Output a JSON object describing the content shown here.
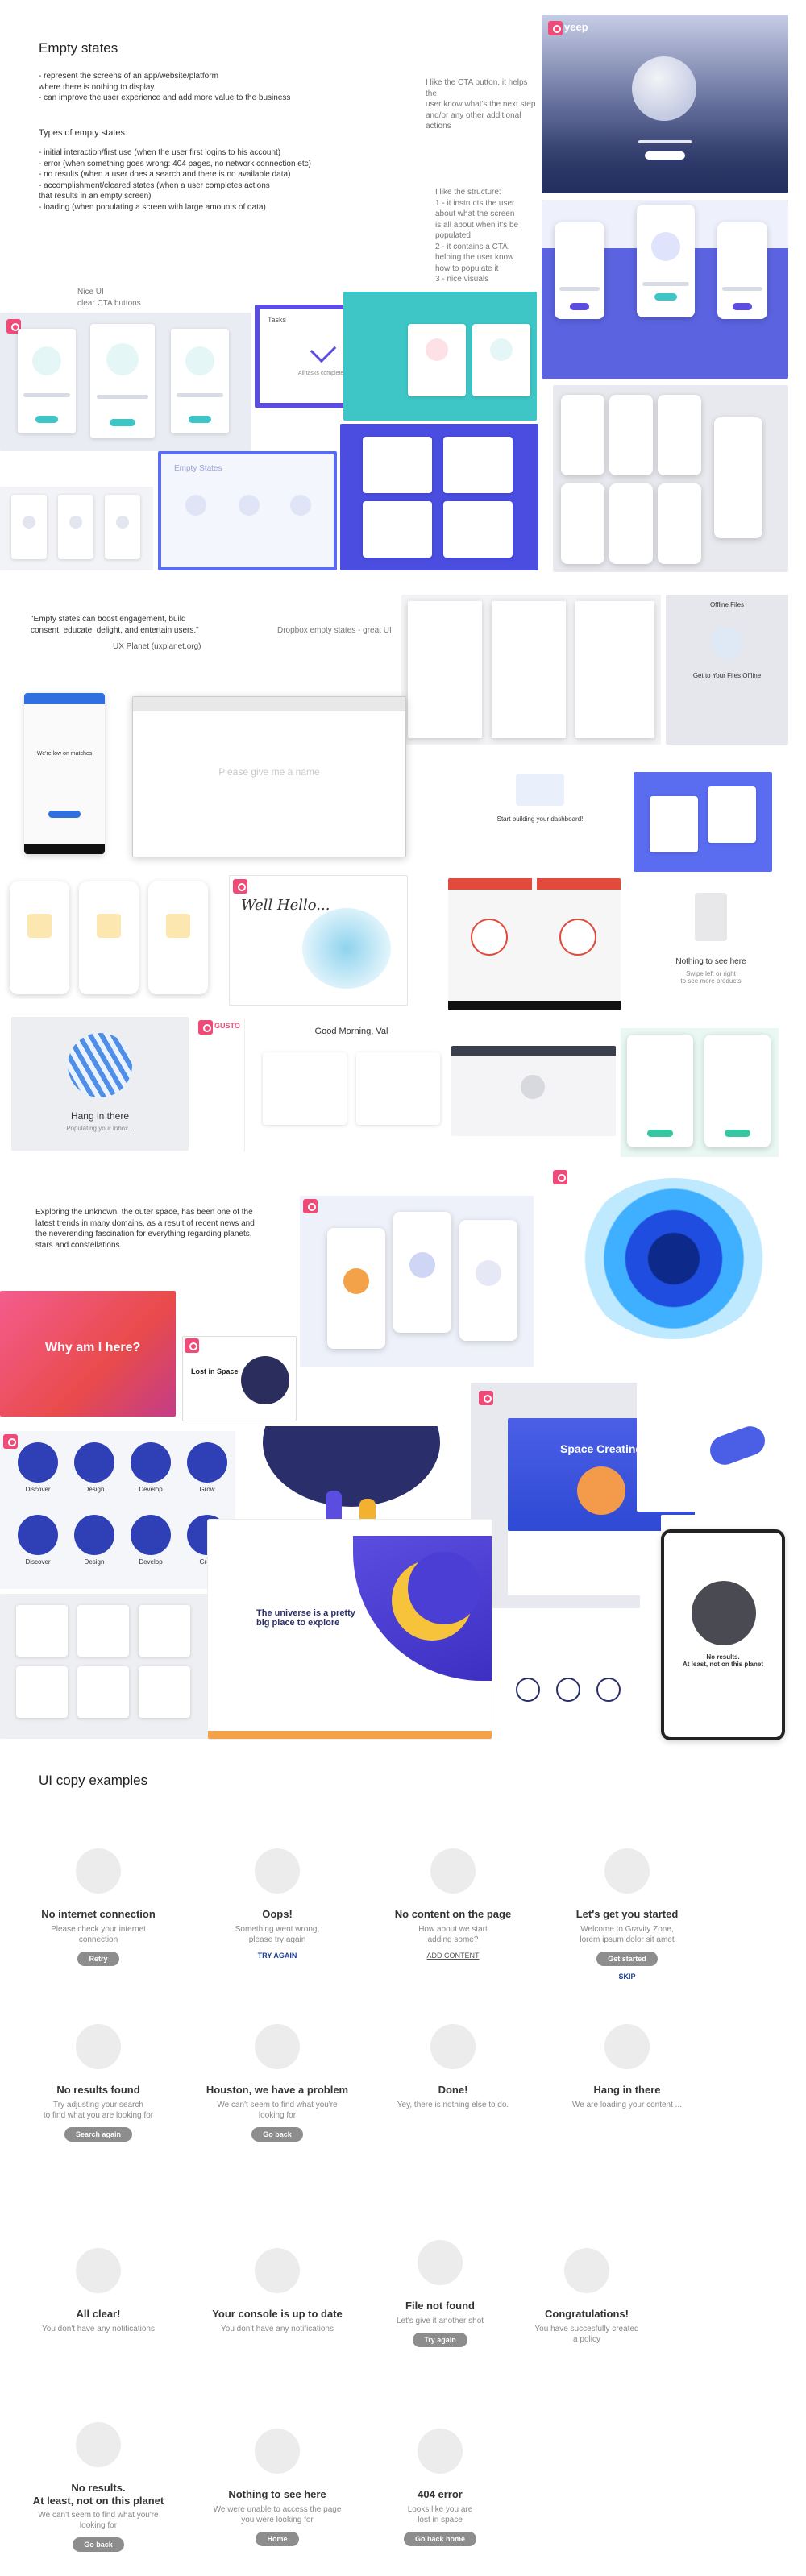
{
  "section1": {
    "title": "Empty states",
    "intro_lines": "- represent the screens of an app/website/platform\nwhere there is nothing to display\n- can improve the user experience and add more value to the business",
    "types_title": "Types of empty states:",
    "types_lines": "- initial interaction/first use (when the user first logins to his account)\n- error (when something goes wrong: 404 pages, no network connection etc)\n- no results (when a user does a search and there is no available data)\n- accomplishment/cleared states (when a user completes actions\nthat results in an empty screen)\n- loading (when populating a screen with large amounts of data)",
    "note_cta": "I like the CTA button, it helps the\nuser know what's the next step\nand/or any other additional\nactions",
    "note_structure": "I like the structure:\n1 - it instructs the user\nabout what the screen\nis all about when it's be\npopulated\n2 - it contains a CTA,\nhelping the user know\nhow to populate it\n3 - nice visuals",
    "note_nice_ui": "Nice UI\nclear CTA buttons",
    "tasks_title": "Tasks",
    "tasks_msg": "All tasks completed!",
    "space_brand": "yeep",
    "empty_states_label": "Empty States"
  },
  "section2": {
    "quote": "\"Empty states can boost engagement, build\nconsent, educate, delight, and entertain users.\"",
    "source": "UX Planet (uxplanet.org)",
    "dropbox_note": "Dropbox empty states - great UI",
    "offline_title": "Offline Files",
    "offline_sub": "Get to Your Files Offline",
    "browser_text": "Please give me a name",
    "dashboard_text": "Start building your dashboard!",
    "nothing_title": "Nothing to see here",
    "nothing_sub": "Swipe left or right\nto see more products",
    "hello_title": "Well Hello...",
    "hang_title": "Hang in there",
    "hang_sub": "Populating your inbox...",
    "morning_title": "Good Morning, Val",
    "gusto": "GUSTO",
    "were_text": "We're low on matches"
  },
  "section3": {
    "intro": "Exploring the unknown, the outer space, has been one of the\nlatest trends in many domains, as a result of recent news and\nthe neverending fascination for everything regarding planets,\nstars and constellations.",
    "why_title": "Why am I here?",
    "lost_title": "Lost in Space",
    "space_creating": "Space Creating",
    "universe_title": "The universe is a pretty\nbig place to explore",
    "no_results_title": "No results.\nAt least, not on this planet",
    "icons": [
      "Discover",
      "Design",
      "Develop",
      "Grow",
      "Discover",
      "Design",
      "Develop",
      "Grow"
    ]
  },
  "ui_copy": {
    "title": "UI copy examples",
    "rows": [
      [
        {
          "title": "No internet connection",
          "desc": "Please check your internet\nconnection",
          "button": "Retry"
        },
        {
          "title": "Oops!",
          "desc": "Something went wrong,\nplease try again",
          "link": "TRY AGAIN",
          "link_color": "#1c3f94"
        },
        {
          "title": "No content on the page",
          "desc": "How about we start\nadding some?",
          "link": "ADD CONTENT",
          "link_color": "#555555",
          "underline": true
        },
        {
          "title": "Let's get you started",
          "desc": "Welcome to Gravity Zone,\nlorem ipsum dolor sit amet",
          "button": "Get started",
          "link": "SKIP",
          "link_color": "#1c3f94"
        }
      ],
      [
        {
          "title": "No results found",
          "desc": "Try adjusting your search\nto find what you are looking for",
          "button": "Search again"
        },
        {
          "title": "Houston, we have a problem",
          "desc": "We can't seem to find what you're\nlooking for",
          "button": "Go back"
        },
        {
          "title": "Done!",
          "desc": "Yey, there is nothing else to do."
        },
        {
          "title": "Hang in there",
          "desc": "We are loading your content ..."
        }
      ],
      [
        {
          "title": "All clear!",
          "desc": "You don't have any notifications"
        },
        {
          "title": "Your console is up to date",
          "desc": "You don't have any notifications"
        },
        {
          "title": "File not found",
          "desc": "Let's give it another shot",
          "button": "Try again"
        },
        {
          "title": "Congratulations!",
          "desc": "You have succesfully created\na policy"
        }
      ],
      [
        {
          "title": "No results.\nAt least, not on this planet",
          "desc": "We can't seem to find what you're\nlooking for",
          "button": "Go back"
        },
        {
          "title": "Nothing to see here",
          "desc": "We were unable to access the page\nyou were looking for",
          "button": "Home"
        },
        {
          "title": "404 error",
          "desc": "Looks like you are\nlost in space",
          "button": "Go back home"
        }
      ]
    ]
  },
  "colors": {
    "accent_pink": "#f04b78",
    "indigo": "#5a4de0",
    "teal": "#3ec6c6",
    "navy": "#1c2a5a",
    "button_gray": "#8d8d8d"
  }
}
